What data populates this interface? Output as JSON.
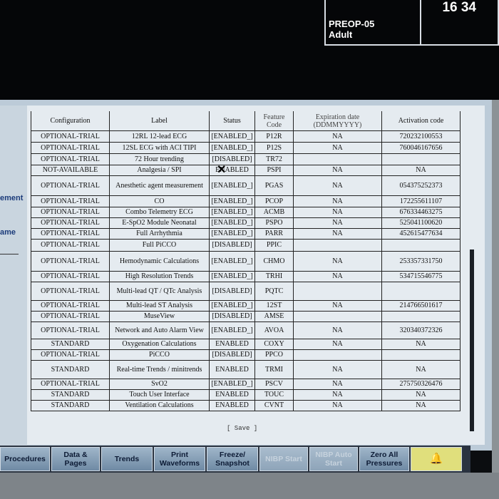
{
  "header": {
    "bed": "PREOP-05",
    "patient_type": "Adult",
    "time": "16 34"
  },
  "sidebar": {
    "label_1": "ement",
    "label_2": "ame"
  },
  "table": {
    "headers": {
      "configuration": "Configuration",
      "label": "Label",
      "status": "Status",
      "feature_code": "Feature Code",
      "expiration_date": "Expiration date (DDMMYYYY)",
      "activation_code": "Activation code"
    },
    "rows": [
      {
        "config": "OPTIONAL-TRIAL",
        "label": "12RL 12-lead ECG",
        "status": "[ENABLED_]",
        "code": "P12R",
        "exp": "NA",
        "act": "720232100553"
      },
      {
        "config": "OPTIONAL-TRIAL",
        "label": "12SL ECG with ACI TIPI",
        "status": "[ENABLED_]",
        "code": "P12S",
        "exp": "NA",
        "act": "760046167656"
      },
      {
        "config": "OPTIONAL-TRIAL",
        "label": "72 Hour trending",
        "status": "[DISABLED]",
        "code": "TR72",
        "exp": "",
        "act": ""
      },
      {
        "config": "NOT-AVAILABLE",
        "label": "Analgesia / SPI",
        "status": "ENABLED",
        "code": "PSPI",
        "exp": "NA",
        "act": "NA"
      },
      {
        "config": "OPTIONAL-TRIAL",
        "label": "Anesthetic agent measurement",
        "status": "[ENABLED_]",
        "code": "PGAS",
        "exp": "NA",
        "act": "054375252373"
      },
      {
        "config": "OPTIONAL-TRIAL",
        "label": "CO",
        "status": "[ENABLED_]",
        "code": "PCOP",
        "exp": "NA",
        "act": "172255611107"
      },
      {
        "config": "OPTIONAL-TRIAL",
        "label": "Combo Telemetry ECG",
        "status": "[ENABLED_]",
        "code": "ACMB",
        "exp": "NA",
        "act": "676334463275"
      },
      {
        "config": "OPTIONAL-TRIAL",
        "label": "E-SpO2 Module Neonatal",
        "status": "[ENABLED_]",
        "code": "PSPO",
        "exp": "NA",
        "act": "525041100620"
      },
      {
        "config": "OPTIONAL-TRIAL",
        "label": "Full Arrhythmia",
        "status": "[ENABLED_]",
        "code": "PARR",
        "exp": "NA",
        "act": "452615477634"
      },
      {
        "config": "OPTIONAL-TRIAL",
        "label": "Full PiCCO",
        "status": "[DISABLED]",
        "code": "PPIC",
        "exp": "",
        "act": ""
      },
      {
        "config": "OPTIONAL-TRIAL",
        "label": "Hemodynamic Calculations",
        "status": "[ENABLED_]",
        "code": "CHMO",
        "exp": "NA",
        "act": "253357331750"
      },
      {
        "config": "OPTIONAL-TRIAL",
        "label": "High Resolution Trends",
        "status": "[ENABLED_]",
        "code": "TRHI",
        "exp": "NA",
        "act": "534715546775"
      },
      {
        "config": "OPTIONAL-TRIAL",
        "label": "Multi-lead QT / QTc Analysis",
        "status": "[DISABLED]",
        "code": "PQTC",
        "exp": "",
        "act": ""
      },
      {
        "config": "OPTIONAL-TRIAL",
        "label": "Multi-lead ST Analysis",
        "status": "[ENABLED_]",
        "code": "12ST",
        "exp": "NA",
        "act": "214766501617"
      },
      {
        "config": "OPTIONAL-TRIAL",
        "label": "MuseView",
        "status": "[DISABLED]",
        "code": "AMSE",
        "exp": "",
        "act": ""
      },
      {
        "config": "OPTIONAL-TRIAL",
        "label": "Network and Auto Alarm View",
        "status": "[ENABLED_]",
        "code": "AVOA",
        "exp": "NA",
        "act": "320340372326"
      },
      {
        "config": "STANDARD",
        "label": "Oxygenation Calculations",
        "status": "ENABLED",
        "code": "COXY",
        "exp": "NA",
        "act": "NA"
      },
      {
        "config": "OPTIONAL-TRIAL",
        "label": "PiCCO",
        "status": "[DISABLED]",
        "code": "PPCO",
        "exp": "",
        "act": ""
      },
      {
        "config": "STANDARD",
        "label": "Real-time Trends / minitrends",
        "status": "ENABLED",
        "code": "TRMI",
        "exp": "NA",
        "act": "NA"
      },
      {
        "config": "OPTIONAL-TRIAL",
        "label": "SvO2",
        "status": "[ENABLED_]",
        "code": "PSCV",
        "exp": "NA",
        "act": "275750326476"
      },
      {
        "config": "STANDARD",
        "label": "Touch User Interface",
        "status": "ENABLED",
        "code": "TOUC",
        "exp": "NA",
        "act": "NA"
      },
      {
        "config": "STANDARD",
        "label": "Ventilation Calculations",
        "status": "ENABLED",
        "code": "CVNT",
        "exp": "NA",
        "act": "NA"
      }
    ]
  },
  "save_label": "[ Save ]",
  "buttons": [
    {
      "label": "Procedures",
      "disabled": false
    },
    {
      "label": "Data & Pages",
      "disabled": false
    },
    {
      "label": "Trends",
      "disabled": false
    },
    {
      "label": "Print Waveforms",
      "disabled": false
    },
    {
      "label": "Freeze/ Snapshot",
      "disabled": false
    },
    {
      "label": "NIBP Start",
      "disabled": true
    },
    {
      "label": "NIBP Auto Start",
      "disabled": true
    },
    {
      "label": "Zero All Pressures",
      "disabled": false
    }
  ],
  "alarm_icon": "alarm-bell-icon",
  "colors": {
    "screen_bg": "#bccbd8",
    "panel_bg": "#e5ebf0",
    "alarm_button": "#e0df7c"
  }
}
